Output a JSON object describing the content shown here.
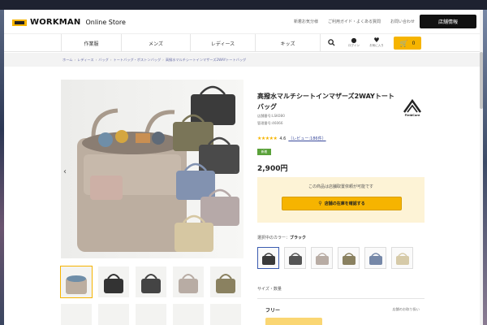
{
  "header": {
    "brand": "WORKMAN",
    "brand_sub": "Online Store",
    "links": [
      "新着お気分様",
      "ご利用ガイド・よくある質問",
      "お問い合わせ"
    ],
    "store_button": "店舗情報"
  },
  "nav": {
    "categories": [
      "作業服",
      "メンズ",
      "レディース",
      "キッズ"
    ],
    "login_label": "ログイン",
    "favorites_label": "お気に入り",
    "cart_count": "0"
  },
  "breadcrumb": [
    "ホーム",
    "レディース",
    "バッグ",
    "トートバッグ・ボストンバッグ",
    "高撥水マルチシートインマザーズ2WAYトートバッグ"
  ],
  "product": {
    "title": "高撥水マルチシートインマザーズ2WAYトートバッグ",
    "brand_logo_text": "FieldCore",
    "store_code": "店舗番号:LSK080",
    "control_code": "管理番号:46066",
    "rating": "4.6",
    "review_link": "（レビュー:186件）",
    "badge": "新着",
    "price": "2,900円",
    "stock_note": "この商品は店舗取置依頼が可能です",
    "stock_button": "店舗の在庫を確認する",
    "color_label_prefix": "選択中のカラー：",
    "color_selected": "ブラック",
    "size_label": "サイズ・数量",
    "size_name": "フリー",
    "size_note": "店舗のお取り扱い"
  },
  "colors": {
    "accent": "#f6b400",
    "swatches": [
      "#3a3a3a",
      "#555555",
      "#b8aca4",
      "#8a8160",
      "#7688a8",
      "#d6caa8"
    ]
  }
}
